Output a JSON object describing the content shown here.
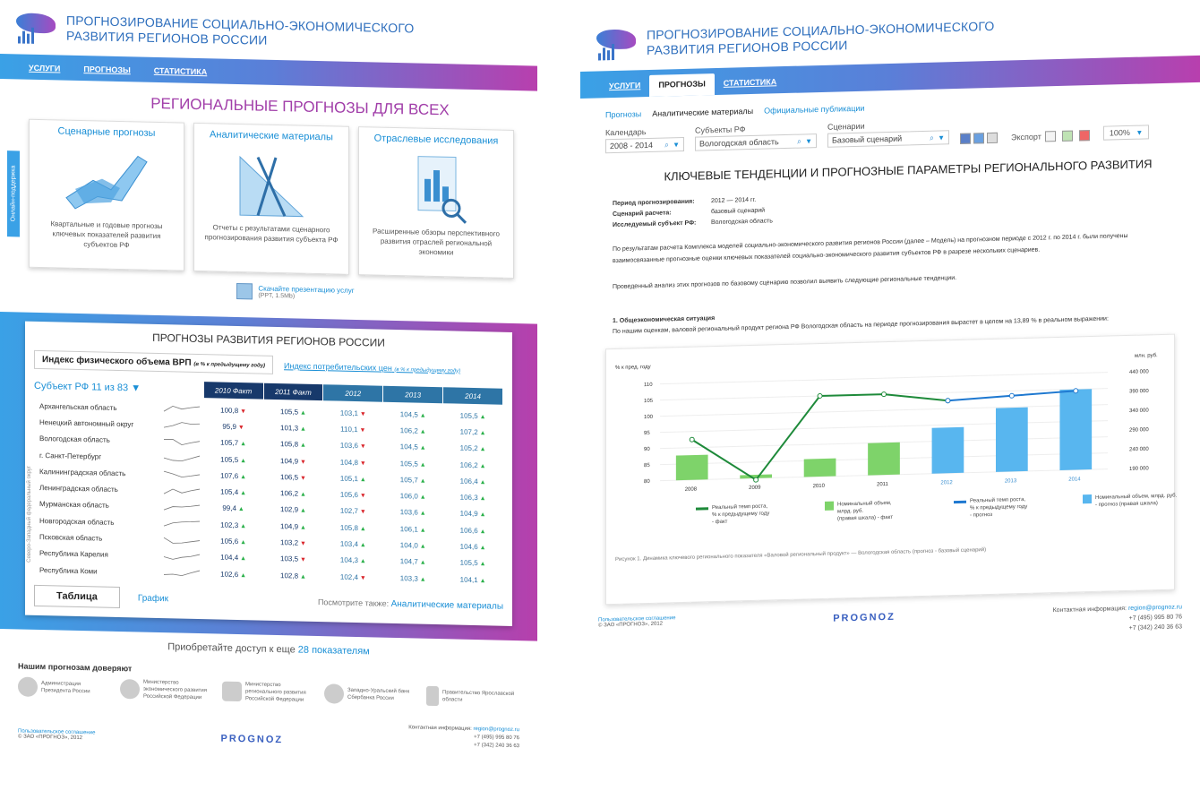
{
  "brand": {
    "title_line1": "ПРОГНОЗИРОВАНИЕ СОЦИАЛЬНО-ЭКОНОМИЧЕСКОГО",
    "title_line2": "РАЗВИТИЯ РЕГИОНОВ РОССИИ",
    "accent": "#3aa1e6",
    "accent2": "#b63fac"
  },
  "nav": {
    "services": "УСЛУГИ",
    "forecasts": "ПРОГНОЗЫ",
    "statistics": "СТАТИСТИКА"
  },
  "left": {
    "banner": "РЕГИОНАЛЬНЫЕ ПРОГНОЗЫ ДЛЯ ВСЕХ",
    "support_tab": "Онлайн-поддержка",
    "cards": [
      {
        "link": "Сценарные прогнозы",
        "text": "Квартальные и годовые прогнозы ключевых показателей развития субъектов РФ"
      },
      {
        "link": "Аналитические материалы",
        "text": "Отчеты с результатами сценарного прогнозирования развития субъекта РФ"
      },
      {
        "link": "Отраслевые исследования",
        "text": "Расширенные обзоры перспективного развития отраслей региональной экономики"
      }
    ],
    "download": {
      "link": "Скачайте презентацию услуг",
      "size": "(PPT, 1.5Mb)"
    },
    "panel": {
      "title": "ПРОГНОЗЫ РАЗВИТИЯ РЕГИОНОВ РОССИИ",
      "tab_active": "Индекс физического объема ВРП",
      "tab_active_note": "(в % к предыдущему году)",
      "tab_other": "Индекс потребительских цен",
      "tab_other_note": "(в % к предыдущему году)",
      "region_select": "Субъект РФ 11 из 83",
      "columns": [
        "2010 Факт",
        "2011 Факт",
        "2012",
        "2013",
        "2014"
      ],
      "district_label": "Северо-Западный федеральный округ",
      "rows": [
        {
          "name": "Архангельская область",
          "v": [
            "100,8",
            "105,5",
            "103,1",
            "104,5",
            "105,5"
          ],
          "d": [
            "dn",
            "up",
            "dn",
            "up",
            "up"
          ]
        },
        {
          "name": "Ненецкий автономный округ",
          "v": [
            "95,9",
            "101,3",
            "110,1",
            "106,2",
            "107,2"
          ],
          "d": [
            "dn",
            "up",
            "dn",
            "up",
            "up"
          ]
        },
        {
          "name": "Вологодская область",
          "v": [
            "105,7",
            "105,8",
            "103,6",
            "104,5",
            "105,2"
          ],
          "d": [
            "up",
            "up",
            "dn",
            "up",
            "up"
          ]
        },
        {
          "name": "г. Санкт-Петербург",
          "v": [
            "105,5",
            "104,9",
            "104,8",
            "105,5",
            "106,2"
          ],
          "d": [
            "up",
            "dn",
            "dn",
            "up",
            "up"
          ]
        },
        {
          "name": "Калининградская область",
          "v": [
            "107,6",
            "106,5",
            "105,1",
            "105,7",
            "106,4"
          ],
          "d": [
            "up",
            "dn",
            "up",
            "up",
            "up"
          ]
        },
        {
          "name": "Ленинградская область",
          "v": [
            "105,4",
            "106,2",
            "105,6",
            "106,0",
            "106,3"
          ],
          "d": [
            "up",
            "up",
            "dn",
            "up",
            "up"
          ]
        },
        {
          "name": "Мурманская область",
          "v": [
            "99,4",
            "102,9",
            "102,7",
            "103,6",
            "104,9"
          ],
          "d": [
            "up",
            "up",
            "dn",
            "up",
            "up"
          ]
        },
        {
          "name": "Новгородская область",
          "v": [
            "102,3",
            "104,9",
            "105,8",
            "106,1",
            "106,6"
          ],
          "d": [
            "up",
            "up",
            "up",
            "up",
            "up"
          ]
        },
        {
          "name": "Псковская область",
          "v": [
            "105,6",
            "103,2",
            "103,4",
            "104,0",
            "104,6"
          ],
          "d": [
            "up",
            "dn",
            "up",
            "up",
            "up"
          ]
        },
        {
          "name": "Республика Карелия",
          "v": [
            "104,4",
            "103,5",
            "104,3",
            "104,7",
            "105,5"
          ],
          "d": [
            "up",
            "dn",
            "up",
            "up",
            "up"
          ]
        },
        {
          "name": "Республика Коми",
          "v": [
            "102,6",
            "102,8",
            "102,4",
            "103,3",
            "104,1"
          ],
          "d": [
            "up",
            "up",
            "dn",
            "up",
            "up"
          ]
        }
      ],
      "btn_table": "Таблица",
      "btn_graph": "График",
      "see_also": "Посмотрите также:",
      "see_also_link": "Аналитические материалы"
    },
    "access_text": "Приобретайте доступ к еще",
    "access_link": "28 показателям",
    "trust_title": "Нашим прогнозам доверяют",
    "trust": [
      "Администрация Президента России",
      "Министерство экономического развития Российской Федерации",
      "Министерство регионального развития Российской Федерации",
      "Западно-Уральский банк Сбербанка России",
      "Правительство Ярославской области"
    ]
  },
  "footer": {
    "agreement": "Пользовательское соглашение",
    "copyright": "© ЗАО «ПРОГНОЗ», 2012",
    "logo": "PROGNOZ",
    "contact_label": "Контактная информация:",
    "email": "region@prognoz.ru",
    "phone1": "+7 (495) 995 80 76",
    "phone2": "+7 (342) 240 36 63"
  },
  "right": {
    "subnav": {
      "forecasts": "Прогнозы",
      "analytics": "Аналитические материалы",
      "official": "Официальные публикации"
    },
    "filters": {
      "calendar_label": "Календарь",
      "calendar_value": "2008 - 2014",
      "subject_label": "Субъекты РФ",
      "subject_value": "Вологодская область",
      "scenario_label": "Сценарии",
      "scenario_value": "Базовый сценарий",
      "export_label": "Экспорт",
      "zoom": "100%"
    },
    "title": "КЛЮЧЕВЫЕ ТЕНДЕНЦИИ И ПРОГНОЗНЫЕ ПАРАМЕТРЫ РЕГИОНАЛЬНОГО РАЗВИТИЯ",
    "meta": [
      {
        "k": "Период прогнозирования:",
        "v": "2012 — 2014 гг."
      },
      {
        "k": "Сценарий расчета:",
        "v": "базовый сценарий"
      },
      {
        "k": "Исследуемый субъект РФ:",
        "v": "Вологодская область"
      }
    ],
    "para1": "По результатам расчета Комплекса моделей социально-экономического развития регионов России (далее – Модель) на прогнозном периоде с 2012 г. по 2014 г. были получены взаимосвязанные прогнозные оценки ключевых показателей социально-экономического развития субъектов РФ в разрезе нескольких сценариев.",
    "para2": "Проведенный анализ этих прогнозов по базовому сценарию позволил выявить следующие региональные тенденции.",
    "section_title": "1. Общеэкономическая ситуация",
    "section_text": "По нашим оценкам, валовой региональный продукт региона РФ Вологодская область на периоде прогнозирования вырастет в целом на 13,89 % в реальном выражении:",
    "caption": "Рисунок 1. Динамика ключевого регионального показателя «Валовой региональный продукт» — Вологодская область (прогноз - базовый сценарий)"
  },
  "chart_data": {
    "type": "bar",
    "categories": [
      "2008",
      "2009",
      "2010",
      "2011",
      "2012",
      "2013",
      "2014"
    ],
    "ylabel": "% к пред. году",
    "y2label": "млн. руб.",
    "ylim": [
      80,
      110
    ],
    "yticks": [
      80,
      85,
      90,
      95,
      100,
      105,
      110
    ],
    "y2lim": [
      190000,
      440000
    ],
    "y2ticks": [
      "190 000",
      "240 000",
      "290 000",
      "340 000",
      "390 000",
      "440 000"
    ],
    "series": [
      {
        "name": "Номинальный объем, млрд. руб. (правая шкала) - факт",
        "kind": "bar",
        "axis": "right",
        "values": [
          254000,
          199000,
          236000,
          273000,
          null,
          null,
          null
        ],
        "color": "#7ed36a"
      },
      {
        "name": "Номинальный объем, млрд. руб. - прогноз (правая шкала)",
        "kind": "bar",
        "axis": "right",
        "values": [
          null,
          null,
          null,
          null,
          308000,
          355000,
          398000
        ],
        "color": "#58b6ef"
      },
      {
        "name": "Реальный темп роста, % к предыдущему году - факт",
        "kind": "line",
        "axis": "left",
        "values": [
          92.5,
          79.5,
          105,
          105,
          102.5,
          null,
          null
        ],
        "color": "#1e8a3a"
      },
      {
        "name": "Реальный темп роста, % к предыдущему году - прогноз",
        "kind": "line",
        "axis": "left",
        "values": [
          null,
          null,
          null,
          null,
          102.5,
          103.5,
          104.5
        ],
        "color": "#1e78d0"
      }
    ],
    "legend": [
      {
        "l1": "Реальный темп роста,",
        "l2": "% к предыдущему году",
        "l3": "- факт",
        "color": "#1e8a3a",
        "kind": "line"
      },
      {
        "l1": "Номинальный объем,",
        "l2": "млрд. руб.",
        "l3": "(правая шкала) - факт",
        "color": "#7ed36a",
        "kind": "bar"
      },
      {
        "l1": "Реальный темп роста,",
        "l2": "% к предыдущему году",
        "l3": "- прогноз",
        "color": "#1e78d0",
        "kind": "line"
      },
      {
        "l1": "Номинальный объем, млрд. руб.",
        "l2": "- прогноз (правая шкала)",
        "l3": "",
        "color": "#58b6ef",
        "kind": "bar"
      }
    ]
  }
}
